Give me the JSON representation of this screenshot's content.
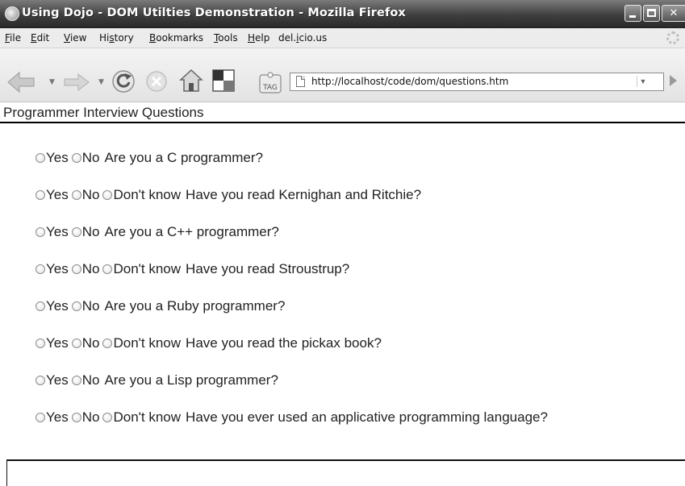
{
  "window": {
    "title": "Using Dojo - DOM Utilties Demonstration - Mozilla Firefox",
    "minimize_label": "",
    "maximize_label": "",
    "close_label": "✕"
  },
  "menu": {
    "items": [
      {
        "pre": "",
        "u": "F",
        "post": "ile"
      },
      {
        "pre": "",
        "u": "E",
        "post": "dit"
      },
      {
        "pre": "",
        "u": "V",
        "post": "iew"
      },
      {
        "pre": "Hi",
        "u": "s",
        "post": "tory"
      },
      {
        "pre": "",
        "u": "B",
        "post": "ookmarks"
      },
      {
        "pre": "",
        "u": "T",
        "post": "ools"
      },
      {
        "pre": "",
        "u": "H",
        "post": "elp"
      },
      {
        "pre": "del.",
        "u": "i",
        "post": "cio.us"
      }
    ]
  },
  "toolbar": {
    "icons": [
      "back-icon",
      "forward-icon",
      "reload-icon",
      "stop-icon",
      "home-icon",
      "checkerboard-icon",
      "tag-icon"
    ],
    "tag_label": "TAG",
    "url": "http://localhost/code/dom/questions.htm",
    "dropdown_glyph": "▼"
  },
  "page": {
    "heading": "Programmer Interview Questions",
    "questions": [
      {
        "options": [
          "Yes",
          "No"
        ],
        "text": "Are you a C programmer?"
      },
      {
        "options": [
          "Yes",
          "No",
          "Don't know"
        ],
        "text": "Have you read Kernighan and Ritchie?"
      },
      {
        "options": [
          "Yes",
          "No"
        ],
        "text": "Are you a C++ programmer?"
      },
      {
        "options": [
          "Yes",
          "No",
          "Don't know"
        ],
        "text": "Have you read Stroustrup?"
      },
      {
        "options": [
          "Yes",
          "No"
        ],
        "text": "Are you a Ruby programmer?"
      },
      {
        "options": [
          "Yes",
          "No",
          "Don't know"
        ],
        "text": "Have you read the pickax book?"
      },
      {
        "options": [
          "Yes",
          "No"
        ],
        "text": "Are you a Lisp programmer?"
      },
      {
        "options": [
          "Yes",
          "No",
          "Don't know"
        ],
        "text": "Have you ever used an applicative programming language?"
      }
    ]
  },
  "colors": {
    "titlebar": "#3f3f3f",
    "rule": "#000000"
  }
}
